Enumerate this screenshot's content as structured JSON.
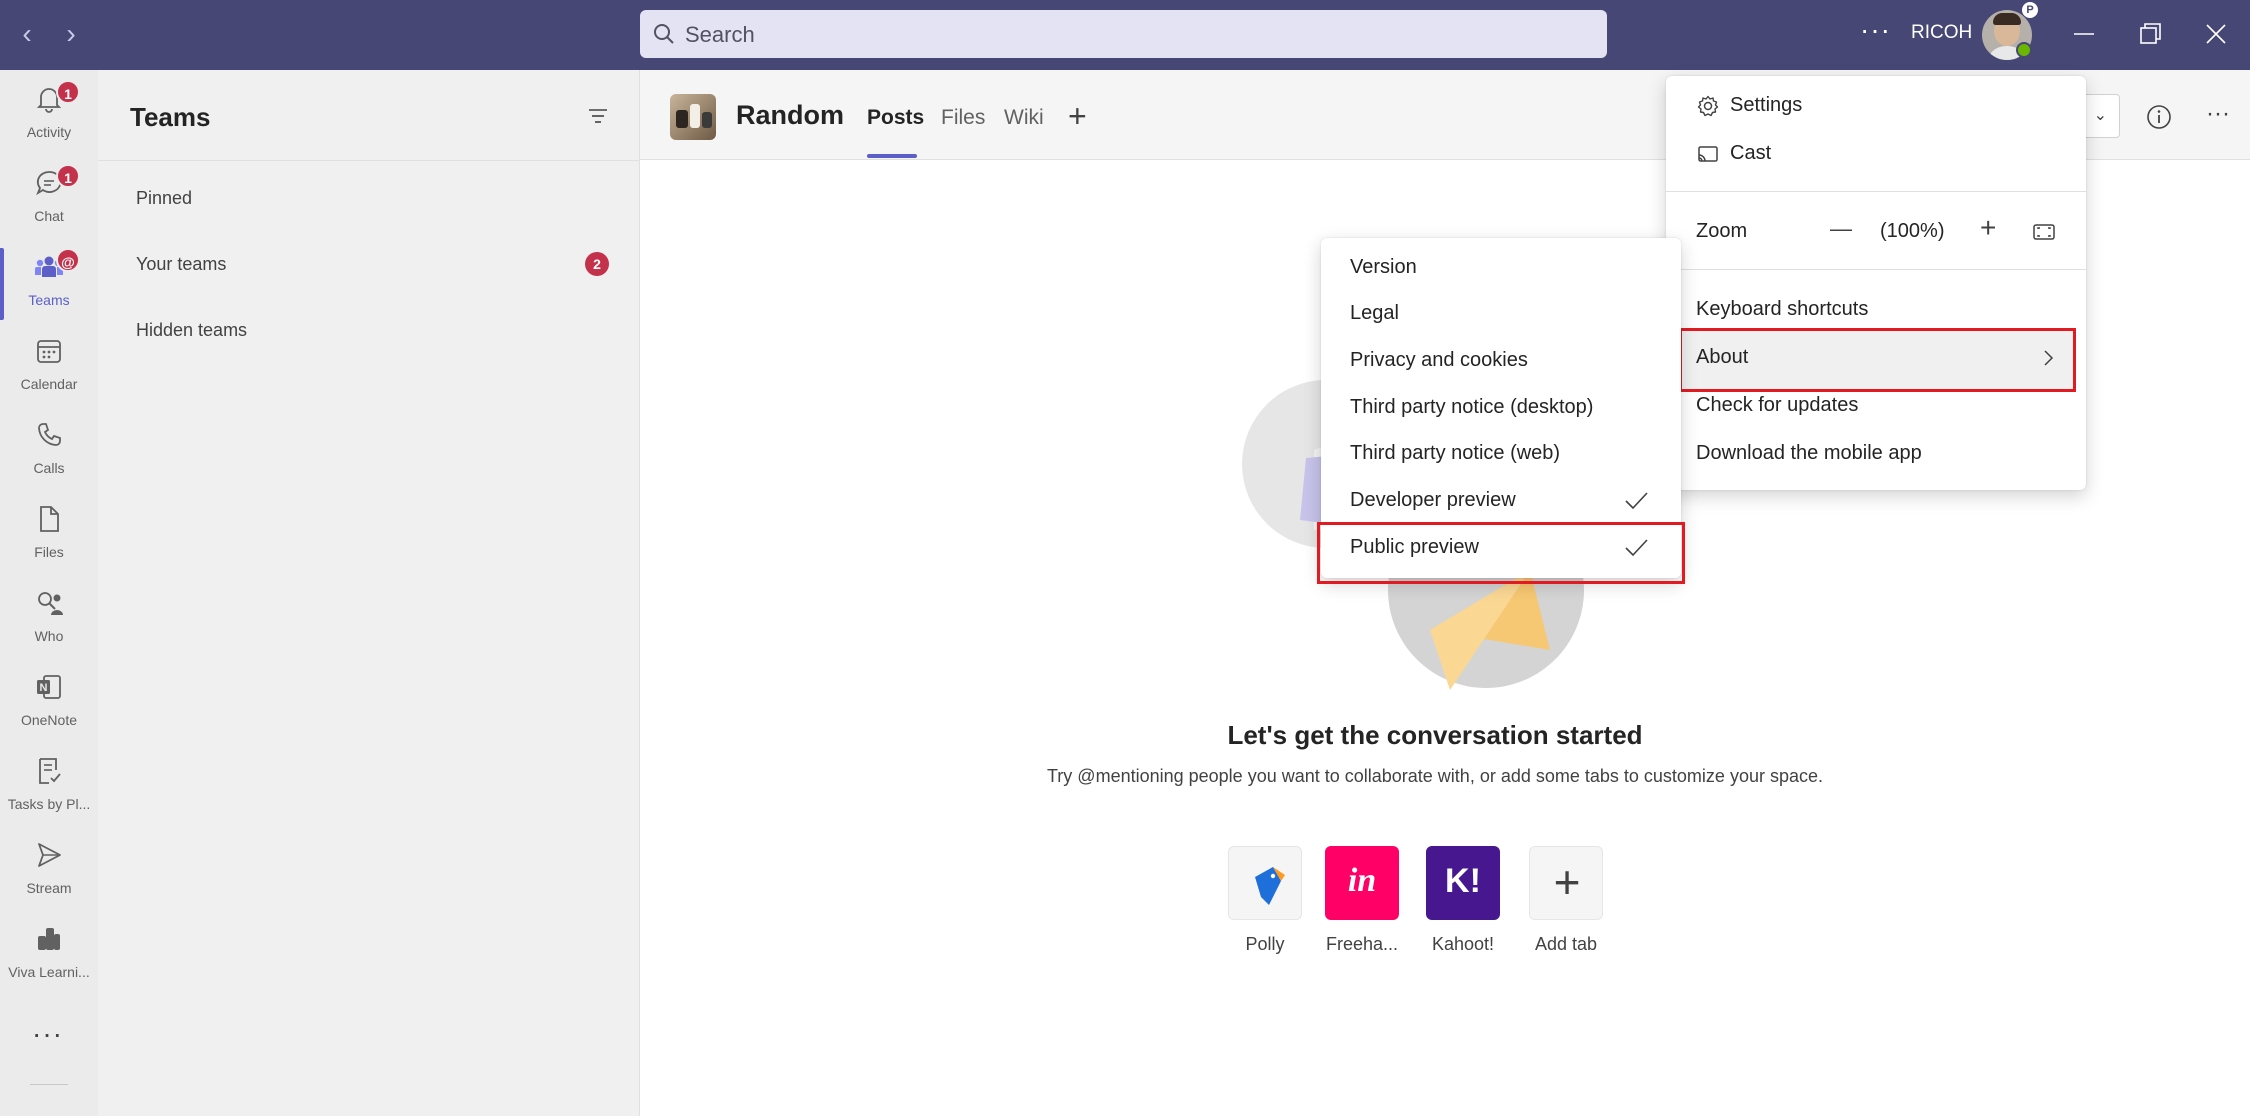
{
  "titlebar": {
    "search_placeholder": "Search",
    "more": "···",
    "org": "RICOH",
    "avatar_badge": "P"
  },
  "rail": {
    "items": [
      {
        "label": "Activity",
        "badge": "1"
      },
      {
        "label": "Chat",
        "badge": "1"
      },
      {
        "label": "Teams",
        "badge": "@"
      },
      {
        "label": "Calendar"
      },
      {
        "label": "Calls"
      },
      {
        "label": "Files"
      },
      {
        "label": "Who"
      },
      {
        "label": "OneNote"
      },
      {
        "label": "Tasks by Pl..."
      },
      {
        "label": "Stream"
      },
      {
        "label": "Viva Learni..."
      }
    ],
    "more": "···"
  },
  "list": {
    "title": "Teams",
    "rows": [
      "Pinned",
      "Your teams",
      "Hidden teams"
    ],
    "your_teams_badge": "2"
  },
  "channel": {
    "name": "Random",
    "tabs": [
      "Posts",
      "Files",
      "Wiki"
    ],
    "empty_title": "Let's get the conversation started",
    "empty_subtitle": "Try @mentioning people you want to collaborate with, or add some tabs to customize your space.",
    "apps": [
      {
        "name": "Polly",
        "color": "#f5f5f5"
      },
      {
        "name": "Freeha...",
        "color": "#ff0066",
        "glyph": "in"
      },
      {
        "name": "Kahoot!",
        "color": "#46178f",
        "glyph": "K!"
      },
      {
        "name": "Add tab",
        "color": "#f5f5f5",
        "glyph": "+"
      }
    ]
  },
  "settings_menu": {
    "settings": "Settings",
    "cast": "Cast",
    "zoom_label": "Zoom",
    "zoom_value": "(100%)",
    "zoom_minus": "—",
    "zoom_plus": "+",
    "keyboard_shortcuts": "Keyboard shortcuts",
    "about": "About",
    "check_updates": "Check for updates",
    "download_app": "Download the mobile app"
  },
  "about_menu": {
    "items": [
      "Version",
      "Legal",
      "Privacy and cookies",
      "Third party notice (desktop)",
      "Third party notice (web)",
      "Developer preview",
      "Public preview"
    ]
  },
  "colors": {
    "titlebar": "#464775",
    "accent": "#5b5fc7",
    "badge": "#c4314b",
    "highlight": "#e21b23"
  }
}
